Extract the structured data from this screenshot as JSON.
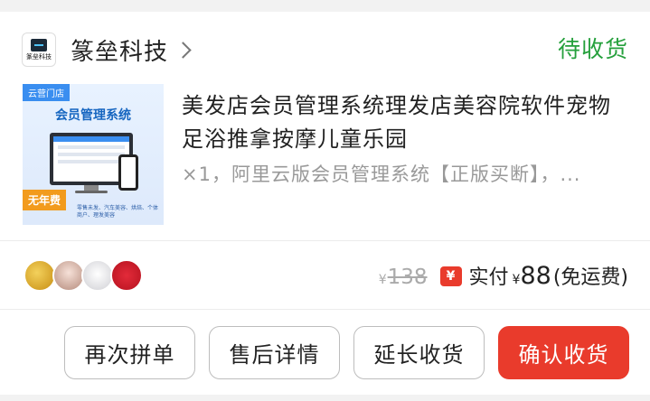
{
  "shop": {
    "name": "篆垒科技",
    "logo_text": "篆垒科技",
    "status": "待收货"
  },
  "product": {
    "thumb_tag": "云营门店",
    "thumb_heading": "会员管理系统",
    "thumb_badge": "无年费",
    "thumb_footer": "零售未发、汽车美容、烘焙、个体商户、理发美容",
    "title": "美发店会员管理系统理发店美容院软件宠物足浴推拿按摩儿童乐园",
    "spec": "×1，阿里云版会员管理系统【正版买断】，..."
  },
  "price": {
    "currency": "¥",
    "original": "138",
    "pay_badge": "¥",
    "paid_label": "实付",
    "paid": "88",
    "shipping": "(免运费)"
  },
  "actions": {
    "rebuy": "再次拼单",
    "after_sale": "售后详情",
    "extend": "延长收货",
    "confirm": "确认收货"
  },
  "colors": {
    "status_green": "#25a03c",
    "primary_red": "#e93b2c"
  }
}
